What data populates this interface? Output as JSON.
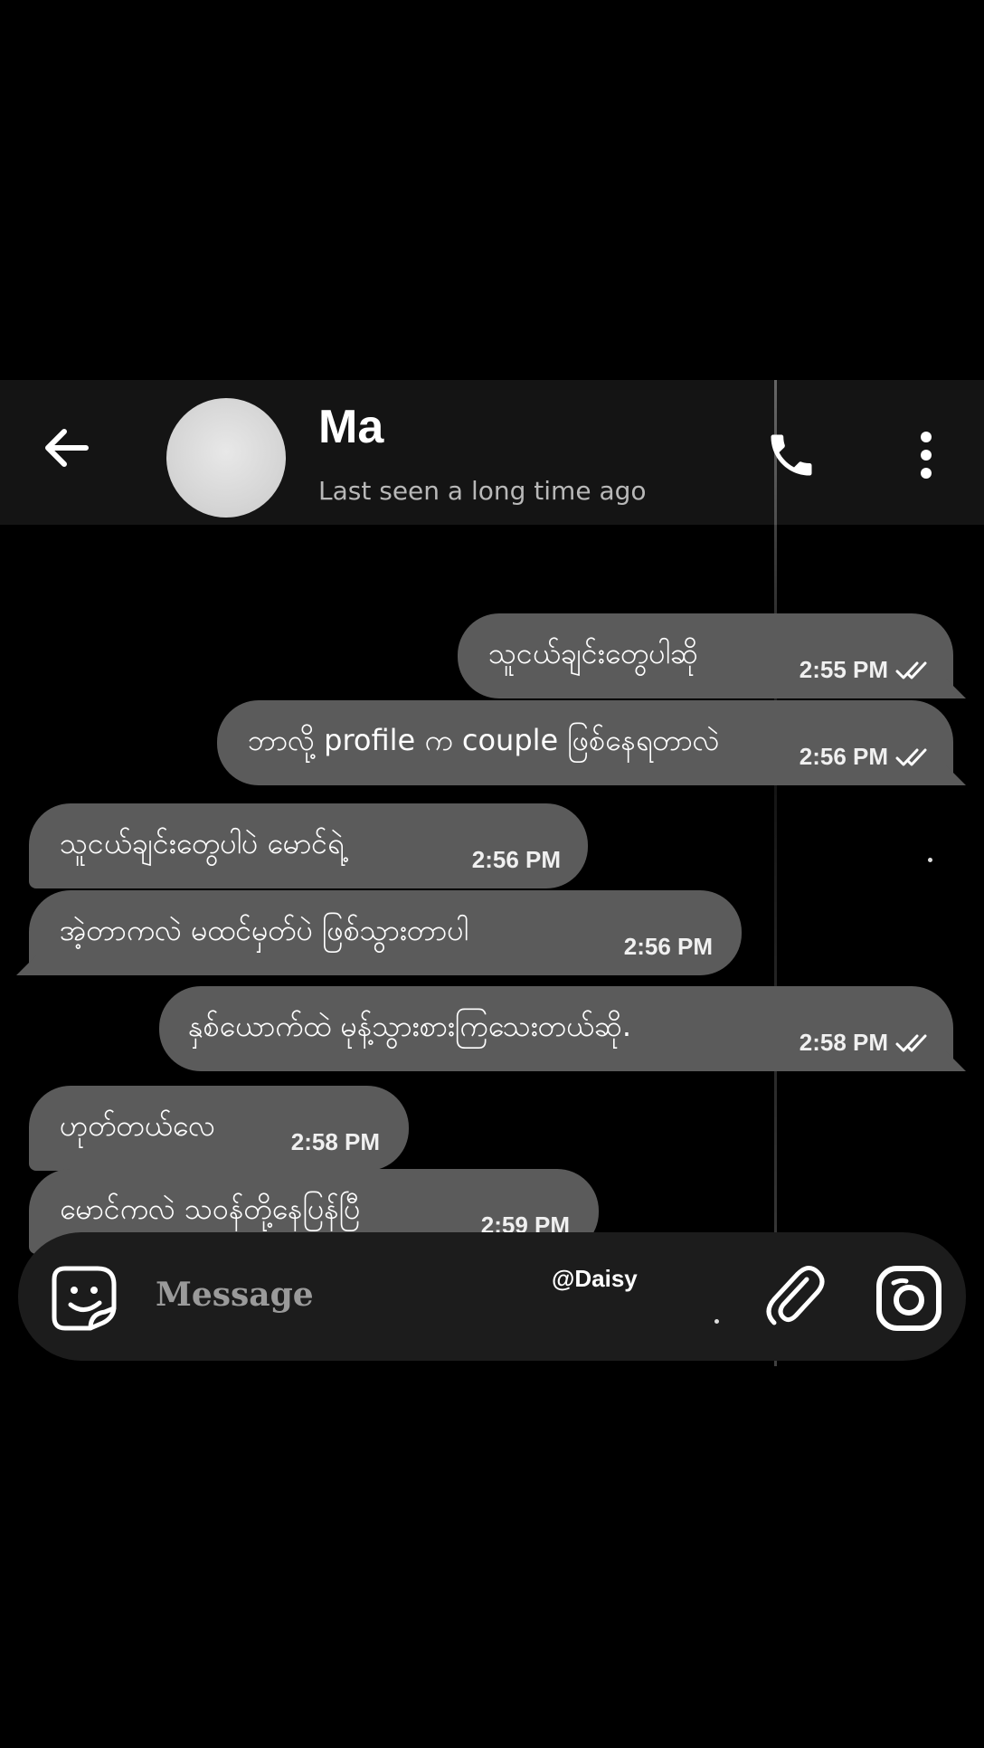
{
  "header": {
    "contact_name": "Ma",
    "status": "Last seen a long time ago"
  },
  "messages": [
    {
      "direction": "out",
      "text": "သူငယ်ချင်းတွေပါဆို",
      "time": "2:55 PM",
      "read": true
    },
    {
      "direction": "out",
      "text": "ဘာလို့ profile က couple ဖြစ်နေရတာလဲ",
      "time": "2:56 PM",
      "read": true
    },
    {
      "direction": "in",
      "text": "သူငယ်ချင်းတွေပါပဲ မောင်ရဲ့",
      "time": "2:56 PM"
    },
    {
      "direction": "in",
      "text": "အဲ့တာကလဲ မထင်မှတ်ပဲ ဖြစ်သွားတာပါ",
      "time": "2:56 PM"
    },
    {
      "direction": "out",
      "text": "နှစ်ယောက်ထဲ မုန့်သွားစားကြသေးတယ်ဆို.",
      "time": "2:58 PM",
      "read": true
    },
    {
      "direction": "in",
      "text": "ဟုတ်တယ်လေ",
      "time": "2:58 PM"
    },
    {
      "direction": "in",
      "text": "မောင်ကလဲ သဝန်တို့နေပြန်ပြီ",
      "time": "2:59 PM"
    }
  ],
  "composer": {
    "placeholder": "Message",
    "watermark": "@Daisy"
  },
  "icons": {
    "back": "arrow-left-icon",
    "call": "phone-icon",
    "menu": "more-vertical-icon",
    "sticker": "sticker-icon",
    "attach": "paperclip-icon",
    "camera": "camera-icon",
    "read": "double-check-icon"
  },
  "colors": {
    "background": "#000000",
    "header": "#141414",
    "bubble": "#5b5b5b",
    "input_bar": "#1c1c1c"
  }
}
